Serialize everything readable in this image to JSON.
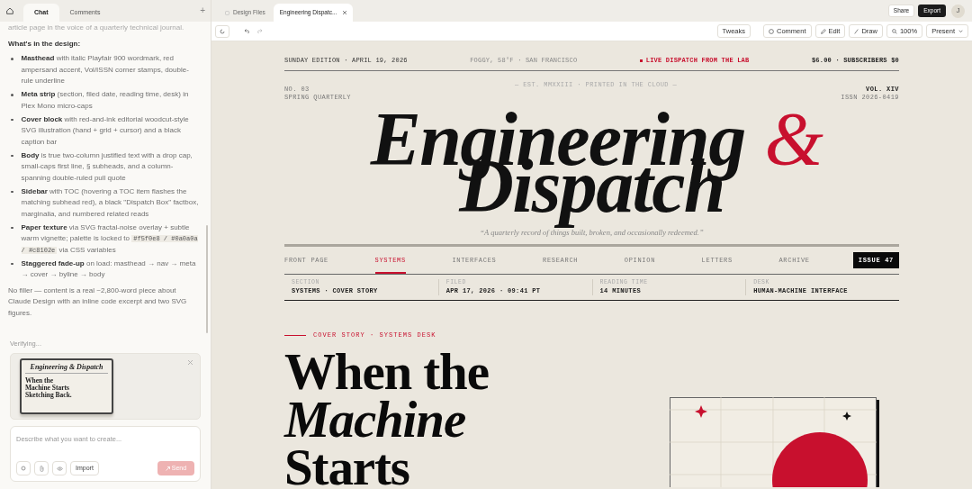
{
  "sidebar": {
    "tabs": [
      {
        "label": "Chat",
        "selected": true
      },
      {
        "label": "Comments",
        "selected": false
      }
    ],
    "add_label": "+",
    "message": {
      "intro": "article page in the voice of a quarterly technical journal.",
      "heading": "What's in the design:",
      "bullets": [
        {
          "title": "Masthead",
          "text": "with italic Playfair 900 wordmark, red ampersand accent, Vol/ISSN corner stamps, double-rule underline"
        },
        {
          "title": "Meta strip",
          "text": "(section, filed date, reading time, desk) in Plex Mono micro-caps"
        },
        {
          "title": "Cover block",
          "text": "with red-and-ink editorial woodcut-style SVG illustration (hand + grid + cursor) and a black caption bar"
        },
        {
          "title": "Body",
          "text": "is true two-column justified text with a drop cap, small-caps first line, § subheads, and a column-spanning double-ruled pull quote"
        },
        {
          "title": "Sidebar",
          "text": "with TOC (hovering a TOC item flashes the matching subhead red), a black \"Dispatch Box\" factbox, marginalia, and numbered related reads"
        },
        {
          "title": "Paper texture",
          "text": "via SVG fractal-noise overlay + subtle warm vignette; palette is locked to",
          "code": "#f5f0e8 / #0a0a0a / #c8102e",
          "text_after": "via CSS variables"
        },
        {
          "title": "Staggered fade-up",
          "text": "on load: masthead → nav → meta → cover → byline → body"
        }
      ],
      "closing": "No filler — content is a real ~2,800-word piece about Claude Design with an inline code excerpt and two SVG figures."
    },
    "status": "Verifying...",
    "preview": {
      "title": "Engineering & Dispatch",
      "headline": "When the Machine Starts Sketching Back."
    },
    "composer": {
      "placeholder": "Describe what you want to create...",
      "import_button": "Import",
      "send_button": "Send",
      "send_disabled": true
    }
  },
  "topbar": {
    "tabs": [
      {
        "label": "Design Files",
        "selected": false
      },
      {
        "label": "Engineering Dispatc...",
        "selected": true
      }
    ],
    "buttons": [
      "Share",
      "Export"
    ],
    "avatar": "J"
  },
  "toolbar": {
    "buttons": [
      {
        "kind": "plain",
        "label": "Tweaks"
      },
      {
        "kind": "comment",
        "label": "Comment"
      },
      {
        "kind": "edit",
        "label": "Edit"
      },
      {
        "kind": "draw",
        "label": "Draw"
      },
      {
        "kind": "zoom",
        "label": "100%"
      },
      {
        "kind": "present",
        "label": "Present"
      }
    ]
  },
  "document": {
    "dateline": {
      "edition": "SUNDAY EDITION · APRIL 19, 2026",
      "weather": "FOGGY, 58°F · SAN FRANCISCO",
      "live": "LIVE DISPATCH FROM THE LAB",
      "price": "$6.00 · SUBSCRIBERS $0"
    },
    "masthead": {
      "number": "NO. 03",
      "season": "SPRING QUARTERLY",
      "est": "— EST. MMXXIII · PRINTED IN THE CLOUD —",
      "volume": "VOL. XIV",
      "issn": "ISSN 2026-0419",
      "title_first": "Engineering",
      "ampersand": "&",
      "title_second": "Dispatch",
      "tagline": "“A quarterly record of things built, broken, and occasionally redeemed.”"
    },
    "nav": [
      {
        "label": "FRONT PAGE",
        "selected": false
      },
      {
        "label": "SYSTEMS",
        "selected": true
      },
      {
        "label": "INTERFACES",
        "selected": false
      },
      {
        "label": "RESEARCH",
        "selected": false
      },
      {
        "label": "OPINION",
        "selected": false
      },
      {
        "label": "LETTERS",
        "selected": false
      },
      {
        "label": "ARCHIVE",
        "selected": false
      }
    ],
    "issue": "ISSUE 47",
    "meta": [
      {
        "label": "SECTION",
        "value": "SYSTEMS · COVER STORY"
      },
      {
        "label": "FILED",
        "value": "APR 17, 2026 · 09:41 PT"
      },
      {
        "label": "READING TIME",
        "value": "14 MINUTES"
      },
      {
        "label": "DESK",
        "value": "HUMAN-MACHINE INTERFACE"
      }
    ],
    "kicker": "COVER STORY · SYSTEMS DESK",
    "headline": [
      {
        "text": "When the",
        "italic": false
      },
      {
        "text": "Machine",
        "italic": true
      },
      {
        "text": "Starts",
        "italic": false
      }
    ]
  }
}
